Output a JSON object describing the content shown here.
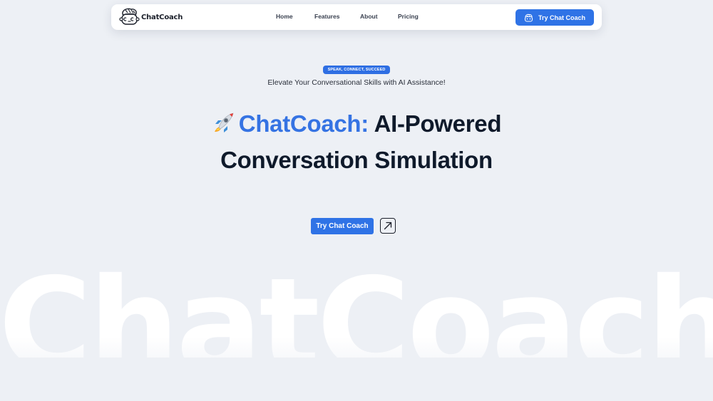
{
  "navbar": {
    "brand_name": "ChatCoach",
    "brand_logo_icon": "cartoon-face-logo-icon",
    "links": [
      {
        "label": "Home"
      },
      {
        "label": "Features"
      },
      {
        "label": "About"
      },
      {
        "label": "Pricing"
      }
    ],
    "cta": {
      "label": "Try Chat Coach",
      "icon": "chat-robot-icon"
    }
  },
  "hero": {
    "badge": "SPEAK, CONNECT, SUCCEED",
    "subtitle": "Elevate Your Conversational Skills with AI Assistance!",
    "headline": {
      "icon": "rocket-emoji",
      "accent": "ChatCoach:",
      "rest_line1": "AI-Powered",
      "line2": "Conversation Simulation"
    },
    "cta_label": "Try Chat Coach",
    "arrow_icon": "arrow-up-right-icon"
  },
  "watermark": "ChatCoach",
  "colors": {
    "accent": "#2f73e6",
    "background": "#edf0f5",
    "heading": "#0f1a2b"
  }
}
